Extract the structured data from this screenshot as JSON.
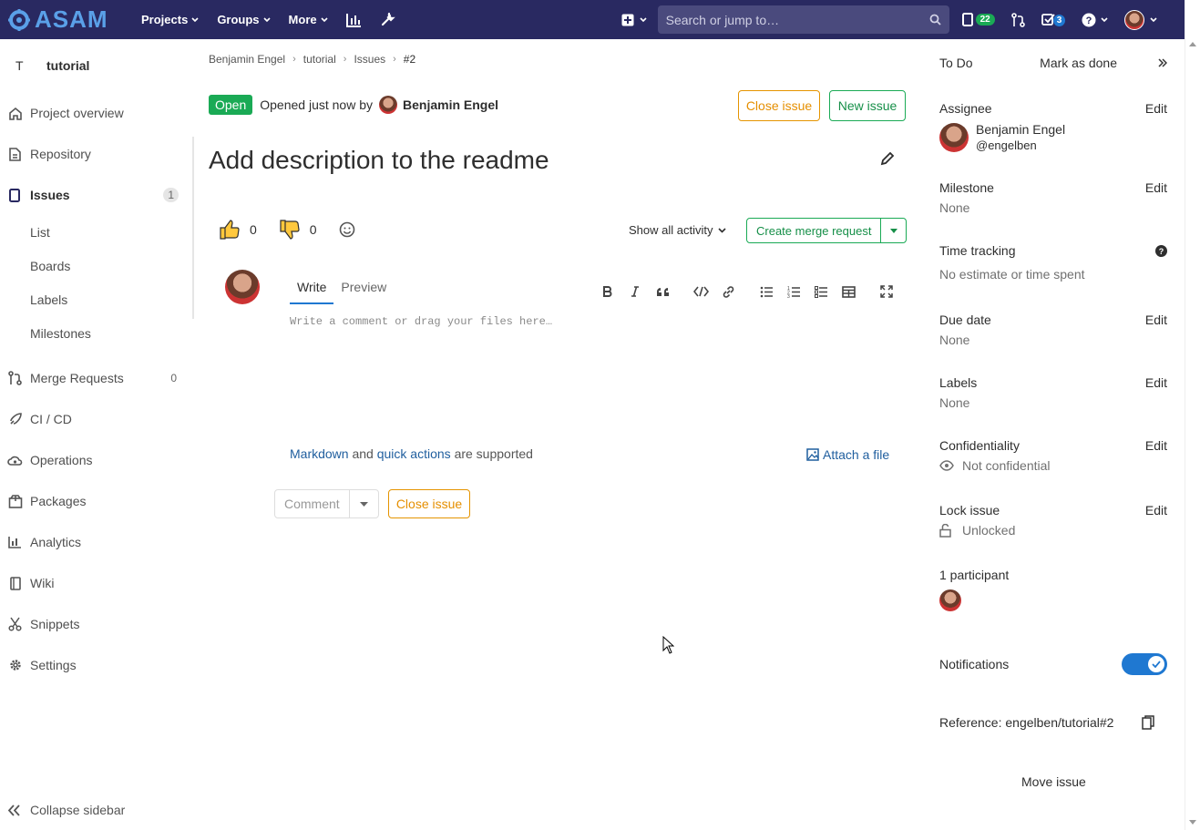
{
  "topbar": {
    "brand": "ASAM",
    "nav": [
      "Projects",
      "Groups",
      "More"
    ],
    "search_placeholder": "Search or jump to…",
    "mr_count": "22",
    "todo_count": "3",
    "bg_color": "#292961"
  },
  "sidebar": {
    "project_letter": "T",
    "project_name": "tutorial",
    "items": {
      "overview": "Project overview",
      "repository": "Repository",
      "issues": "Issues",
      "issues_count": "1",
      "list": "List",
      "boards": "Boards",
      "labels": "Labels",
      "milestones": "Milestones",
      "merge_requests": "Merge Requests",
      "mr_count": "0",
      "cicd": "CI / CD",
      "operations": "Operations",
      "packages": "Packages",
      "analytics": "Analytics",
      "wiki": "Wiki",
      "snippets": "Snippets",
      "settings": "Settings"
    },
    "collapse": "Collapse sidebar"
  },
  "breadcrumb": [
    "Benjamin Engel",
    "tutorial",
    "Issues",
    "#2"
  ],
  "issue": {
    "status": "Open",
    "opened_text": "Opened just now by",
    "author": "Benjamin Engel",
    "close_button": "Close issue",
    "new_button": "New issue",
    "title": "Add description to the readme",
    "thumbs_up": "0",
    "thumbs_down": "0",
    "show_activity": "Show all activity",
    "create_mr": "Create merge request"
  },
  "comment": {
    "tab_write": "Write",
    "tab_preview": "Preview",
    "placeholder": "Write a comment or drag your files here…",
    "markdown_link": "Markdown",
    "and_text": "and",
    "quick_actions_link": "quick actions",
    "supported_text": "are supported",
    "attach": "Attach a file",
    "comment_button": "Comment",
    "close_button": "Close issue"
  },
  "right_sidebar": {
    "todo": "To Do",
    "mark_done": "Mark as done",
    "edit": "Edit",
    "assignee_label": "Assignee",
    "assignee_name": "Benjamin Engel",
    "assignee_user": "@engelben",
    "milestone_label": "Milestone",
    "milestone_value": "None",
    "time_label": "Time tracking",
    "time_value": "No estimate or time spent",
    "due_label": "Due date",
    "due_value": "None",
    "labels_label": "Labels",
    "labels_value": "None",
    "conf_label": "Confidentiality",
    "conf_value": "Not confidential",
    "lock_label": "Lock issue",
    "lock_value": "Unlocked",
    "participants": "1 participant",
    "notifications": "Notifications",
    "notifications_on": true,
    "reference": "Reference: engelben/tutorial#2",
    "move": "Move issue"
  }
}
